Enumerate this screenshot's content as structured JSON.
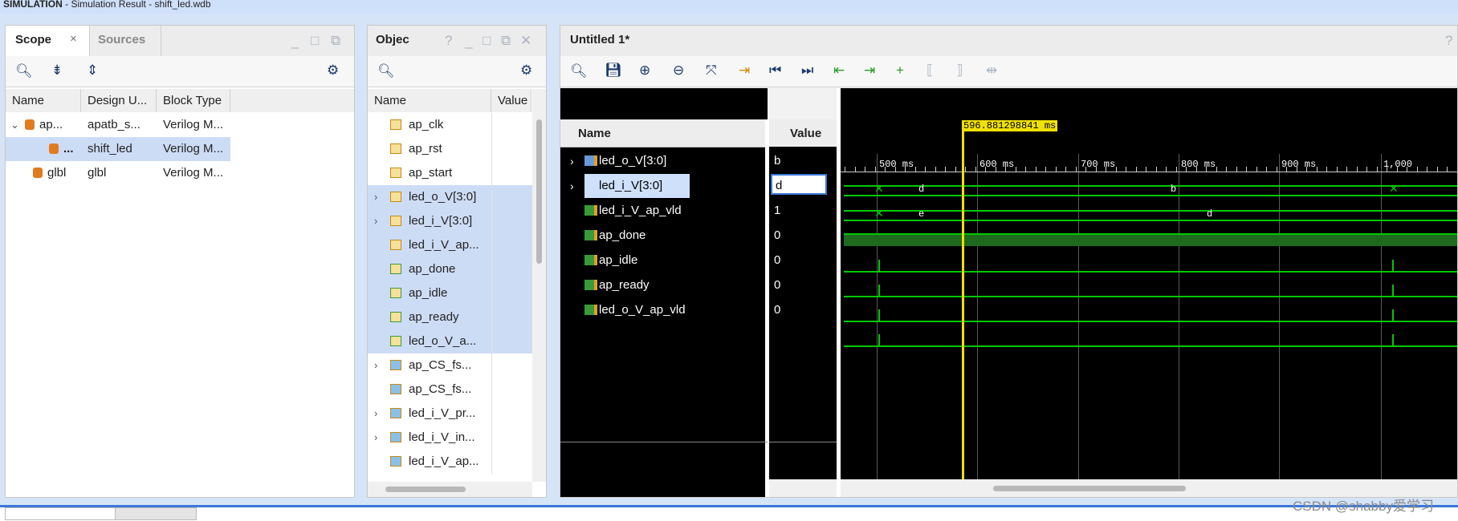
{
  "window": {
    "mode_label": "SIMULATION",
    "title_rest": " - Simulation Result - shift_led.wdb"
  },
  "scope": {
    "tab_scope": "Scope",
    "tab_sources": "Sources",
    "columns": [
      "Name",
      "Design U...",
      "Block Type"
    ],
    "rows": [
      {
        "name": "ap...",
        "design": "apatb_s...",
        "block": "Verilog M..."
      },
      {
        "name": "...",
        "design": "shift_led",
        "block": "Verilog M..."
      },
      {
        "name": "glbl",
        "design": "glbl",
        "block": "Verilog M..."
      }
    ]
  },
  "objects": {
    "title": "Objec",
    "columns": [
      "Name",
      "Value"
    ],
    "rows": [
      {
        "name": "ap_clk"
      },
      {
        "name": "ap_rst"
      },
      {
        "name": "ap_start"
      },
      {
        "name": "led_o_V[3:0]"
      },
      {
        "name": "led_i_V[3:0]"
      },
      {
        "name": "led_i_V_ap..."
      },
      {
        "name": "ap_done"
      },
      {
        "name": "ap_idle"
      },
      {
        "name": "ap_ready"
      },
      {
        "name": "led_o_V_a..."
      },
      {
        "name": "ap_CS_fs..."
      },
      {
        "name": "ap_CS_fs..."
      },
      {
        "name": "led_i_V_pr..."
      },
      {
        "name": "led_i_V_in..."
      },
      {
        "name": "led_i_V_ap..."
      }
    ]
  },
  "wave": {
    "title": "Untitled 1*",
    "help": "?",
    "name_header": "Name",
    "value_header": "Value",
    "cursor_time": "596.881298841 ms",
    "ticks": [
      "500 ms",
      "600 ms",
      "700 ms",
      "800 ms",
      "900 ms",
      "1,000"
    ],
    "signals": [
      {
        "name": "led_o_V[3:0]",
        "value": "b"
      },
      {
        "name": "led_i_V[3:0]",
        "value": "d"
      },
      {
        "name": "led_i_V_ap_vld",
        "value": "1"
      },
      {
        "name": "ap_done",
        "value": "0"
      },
      {
        "name": "ap_idle",
        "value": "0"
      },
      {
        "name": "ap_ready",
        "value": "0"
      },
      {
        "name": "led_o_V_ap_vld",
        "value": "0"
      }
    ],
    "bus_labels": {
      "led_o_a": "d",
      "led_o_b": "b",
      "led_i_a": "e",
      "led_i_b": "d"
    }
  },
  "watermark": "CSDN @shabby爱学习"
}
